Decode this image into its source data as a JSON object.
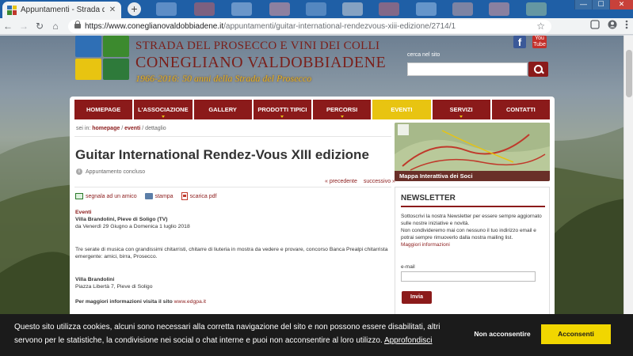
{
  "browser": {
    "tab_title": "Appuntamenti - Strada del Prose",
    "tab_close": "✕",
    "new_tab": "+",
    "win_min": "—",
    "win_max": "☐",
    "win_close": "✕",
    "url_host": "https://www.coneglianovaldobbiadene.it",
    "url_path": "/appuntamenti/guitar-international-rendezvous-xiii-edizione/2714/1",
    "nav_back": "←",
    "nav_forward": "→",
    "nav_reload": "↻",
    "nav_home": "⌂",
    "star": "☆"
  },
  "header": {
    "title_line1": "STRADA DEL PROSECCO E VINI DEI COLLI",
    "title_line2": "CONEGLIANO VALDOBBIADENE",
    "title_line3": "1966-2016: 50 anni della Strada del Prosecco",
    "facebook": "f",
    "youtube": "You Tube",
    "search_label": "cerca nel sito"
  },
  "nav": {
    "items": [
      {
        "label": "HOMEPAGE",
        "dropdown": false,
        "active": false
      },
      {
        "label": "L'ASSOCIAZIONE",
        "dropdown": true,
        "active": false
      },
      {
        "label": "GALLERY",
        "dropdown": false,
        "active": false
      },
      {
        "label": "PRODOTTI TIPICI",
        "dropdown": true,
        "active": false
      },
      {
        "label": "PERCORSI",
        "dropdown": true,
        "active": false
      },
      {
        "label": "EVENTI",
        "dropdown": false,
        "active": true
      },
      {
        "label": "SERVIZI",
        "dropdown": true,
        "active": false
      },
      {
        "label": "CONTATTI",
        "dropdown": false,
        "active": false
      }
    ]
  },
  "breadcrumb": {
    "prefix": "sei in: ",
    "home": "homepage",
    "sep1": " / ",
    "section": "eventi",
    "sep2": " / ",
    "current": "dettaglio"
  },
  "event": {
    "title": "Guitar International Rendez-Vous XIII edizione",
    "status": "Appuntamento concluso",
    "prev": "« precedente",
    "next": "successivo »",
    "action_mail": "segnala ad un amico",
    "action_print": "stampa",
    "action_pdf": "scarica pdf",
    "category": "Eventi",
    "venue_line": "Villa Brandolini, Pieve di Soligo (TV)",
    "dates": "da Venerdì 29 Giugno a Domenica 1 luglio 2018",
    "description": "Tre serate di musica con grandissimi chitarristi, chitarre di liuteria in mostra da vedere e provare, concorso Banca Prealpi chitarrista emergente: amici, birra, Prosecco.",
    "venue_name": "Villa Brandolini",
    "address": "Piazza Libertà 7, Pieve di Soligo",
    "more_info_prefix": "Per maggiori informazioni visita il sito ",
    "more_info_link": "www.edgpa.it"
  },
  "sidebar": {
    "map_caption": "Mappa Interattiva dei Soci",
    "newsletter": {
      "heading": "NEWSLETTER",
      "text": "Sottoscrivi la nostra Newsletter per essere sempre aggiornato sulle nostre iniziative e novità.",
      "privacy": "Non condivideremo mai con nessuno il tuo indirizzo email e potrai sempre rimuoverlo dalla nostra mailing list.",
      "more_link": "Maggiori informazioni",
      "email_label": "e-mail",
      "submit": "Invia"
    }
  },
  "cookie": {
    "text": "Questo sito utilizza cookies, alcuni sono necessari alla corretta navigazione del sito e non possono essere disabilitati, altri servono per le statistiche, la condivisione nei social o chat interne e puoi non acconsentire al loro utilizzo. ",
    "link": "Approfondisci",
    "decline": "Non acconsentire",
    "accept": "Acconsenti"
  },
  "colors": {
    "brand_red": "#8b1a1a",
    "brand_yellow": "#e8c411",
    "cookie_accept": "#f1d600"
  }
}
